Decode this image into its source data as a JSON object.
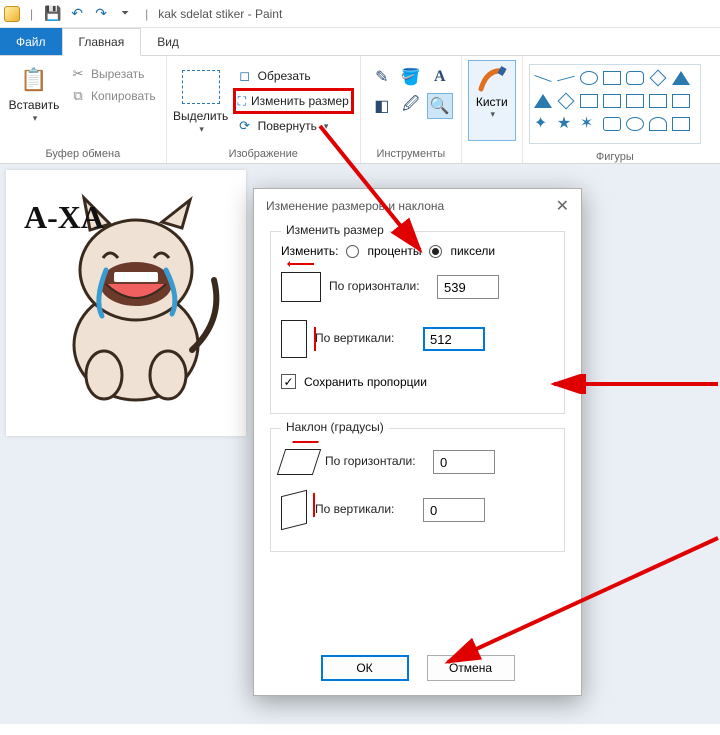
{
  "window": {
    "title": "kak sdelat stiker - Paint"
  },
  "tabs": {
    "file": "Файл",
    "home": "Главная",
    "view": "Вид"
  },
  "ribbon": {
    "clipboard": {
      "paste": "Вставить",
      "cut": "Вырезать",
      "copy": "Копировать",
      "label": "Буфер обмена"
    },
    "image": {
      "select": "Выделить",
      "crop": "Обрезать",
      "resize": "Изменить размер",
      "rotate": "Повернуть",
      "label": "Изображение"
    },
    "tools": {
      "label": "Инструменты"
    },
    "brushes": {
      "label": "Кисти"
    },
    "shapes": {
      "label": "Фигуры"
    }
  },
  "canvas": {
    "sticker_text": "A-XA"
  },
  "dialog": {
    "title": "Изменение размеров и наклона",
    "resize_group": "Изменить размер",
    "by_label": "Изменить:",
    "percent": "проценты",
    "pixels": "пиксели",
    "horizontal": "По горизонтали:",
    "vertical": "По вертикали:",
    "h_value": "539",
    "v_value": "512",
    "keep_ratio": "Сохранить пропорции",
    "skew_group": "Наклон (градусы)",
    "skew_h": "По горизонтали:",
    "skew_v": "По вертикали:",
    "skew_h_value": "0",
    "skew_v_value": "0",
    "ok": "ОК",
    "cancel": "Отмена"
  }
}
